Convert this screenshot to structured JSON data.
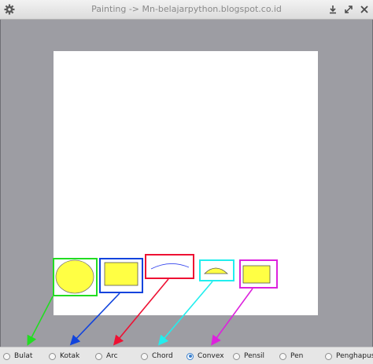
{
  "window": {
    "title": "Painting -> Mn-belajarpython.blogspot.co.id",
    "icons": [
      "gear-icon",
      "download-icon",
      "expand-icon",
      "close-icon"
    ]
  },
  "canvas": {
    "background": "#ffffff",
    "shape_fill": "#ffff44",
    "shapes": [
      "oval",
      "rectangle",
      "arc",
      "chord",
      "rectangle"
    ]
  },
  "annotation_colors": [
    "#22dd22",
    "#1144dd",
    "#ee1133",
    "#22eeee",
    "#dd22dd"
  ],
  "toolbar": {
    "options": [
      {
        "label": "Bulat",
        "checked": false
      },
      {
        "label": "Kotak",
        "checked": false
      },
      {
        "label": "Arc",
        "checked": false
      },
      {
        "label": "Chord",
        "checked": false
      },
      {
        "label": "Convex",
        "checked": true
      },
      {
        "label": "Pensil",
        "checked": false
      },
      {
        "label": "Pen",
        "checked": false
      },
      {
        "label": "Penghapus",
        "checked": false
      }
    ]
  }
}
